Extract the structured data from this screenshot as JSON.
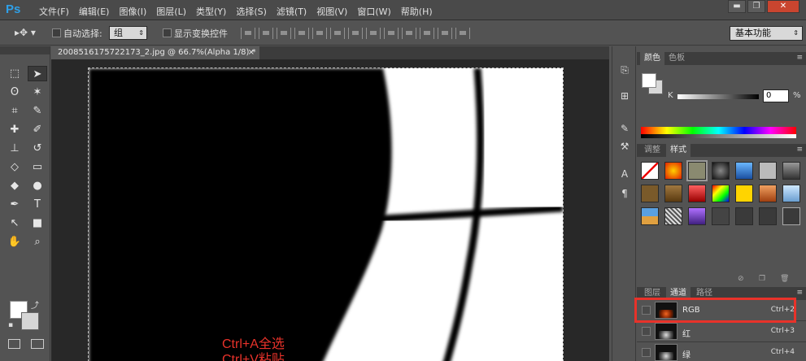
{
  "app": {
    "logo": "Ps"
  },
  "menubar": {
    "items": [
      "文件(F)",
      "编辑(E)",
      "图像(I)",
      "图层(L)",
      "类型(Y)",
      "选择(S)",
      "滤镜(T)",
      "视图(V)",
      "窗口(W)",
      "帮助(H)"
    ]
  },
  "window_buttons": {
    "minimize": "▬",
    "restore": "❐",
    "close": "✕"
  },
  "options": {
    "auto_select_label": "自动选择:",
    "auto_select_value": "组",
    "show_transform_label": "显示变换控件",
    "workspace_value": "基本功能"
  },
  "document": {
    "tab_title": "2008516175722173_2.jpg @ 66.7%(Alpha 1/8) *",
    "close_glyph": "×"
  },
  "annotation": {
    "line1": "Ctrl+A全选",
    "line2": "Ctrl+V粘贴"
  },
  "color_panel": {
    "tabs": [
      "颜色",
      "色板"
    ],
    "channel_label": "K",
    "value": "0",
    "unit": "%"
  },
  "styles_panel": {
    "tabs": [
      "调整",
      "样式"
    ]
  },
  "channels_panel": {
    "tabs": [
      "图层",
      "通道",
      "路径"
    ],
    "rows": [
      {
        "name": "RGB",
        "shortcut": "Ctrl+2"
      },
      {
        "name": "红",
        "shortcut": "Ctrl+3"
      },
      {
        "name": "绿",
        "shortcut": "Ctrl+4"
      }
    ]
  },
  "colors": {
    "accent_ps": "#2fa0e8",
    "annotation_red": "#e8322a",
    "highlight_red": "#e8322a"
  }
}
